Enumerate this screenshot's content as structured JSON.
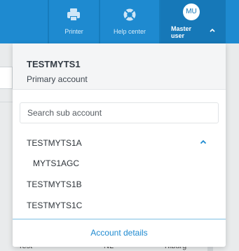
{
  "topbar": {
    "printer_label": "Printer",
    "help_label": "Help center",
    "user_initials": "MU",
    "user_label": "Master user"
  },
  "background_row": {
    "col1": "Test",
    "col2": "NL",
    "col3": "Tilburg"
  },
  "dropdown": {
    "account_name": "TESTMYTS1",
    "account_subtitle": "Primary account",
    "search_placeholder": "Search sub account",
    "items": [
      {
        "label": "TESTMYTS1A",
        "expanded": true
      },
      {
        "label": "MYTS1AGC",
        "child": true
      },
      {
        "label": "TESTMYTS1B"
      },
      {
        "label": "TESTMYTS1C"
      }
    ],
    "footer_link": "Account details"
  },
  "colors": {
    "header_blue": "#1e8ad0",
    "master_blue": "#1678b8",
    "link_blue": "#1e8ad0"
  }
}
